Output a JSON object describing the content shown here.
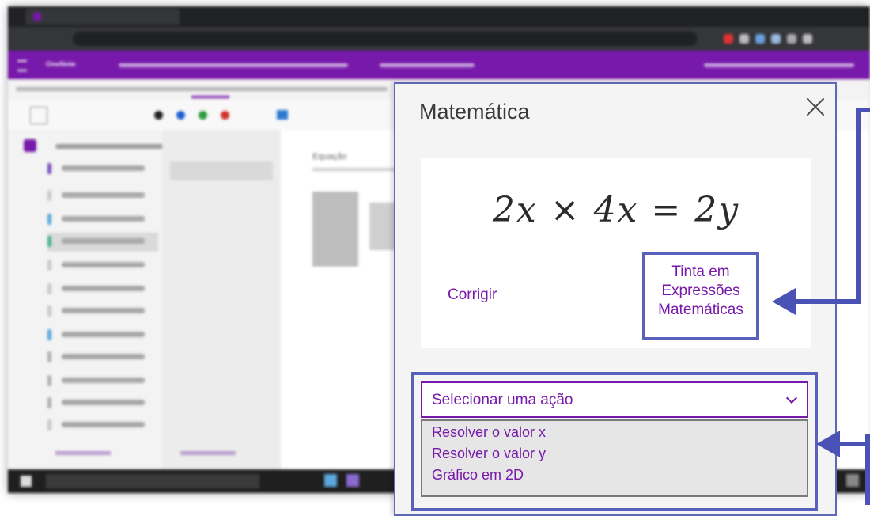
{
  "panel": {
    "title": "Matemática",
    "equation": "2x × 4x = 2y",
    "fix_link": "Corrigir",
    "ink_link": "Tinta em Expressões Matemáticas",
    "action_select": {
      "label": "Selecionar uma ação",
      "options": [
        "Resolver o valor x",
        "Resolver o valor y",
        "Gráfico em 2D"
      ]
    }
  },
  "background": {
    "app_name": "OneNote",
    "section_title": "Equação"
  },
  "colors": {
    "onenote_purple": "#7719aa",
    "highlight_blue": "#5961bc",
    "panel_bg": "#f4f4f4"
  },
  "icons": [
    "close-icon",
    "chevron-down-icon",
    "arrow-left-icon"
  ]
}
